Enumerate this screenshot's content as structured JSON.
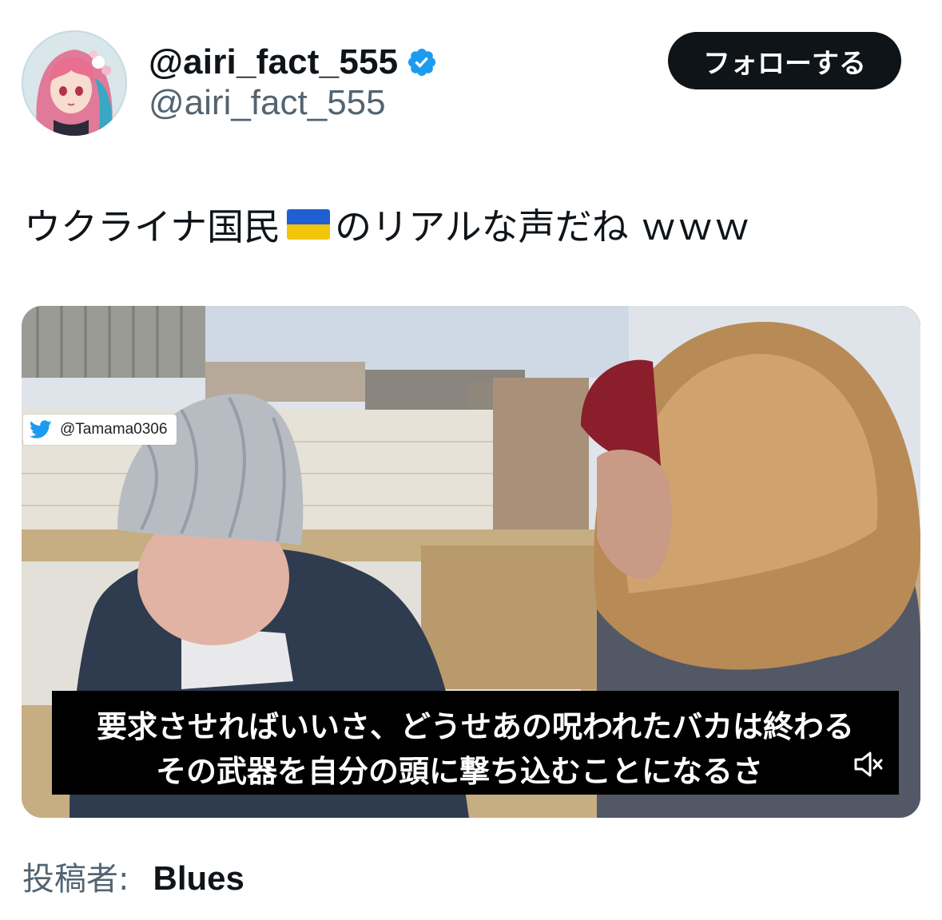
{
  "header": {
    "display_name": "@airi_fact_555",
    "handle": "@airi_fact_555",
    "verified_icon": "verified-badge-icon",
    "follow_label": "フォローする"
  },
  "tweet": {
    "text_before_flag": "ウクライナ国民",
    "flag_icon": "ukraine-flag-emoji",
    "text_after_flag": "のリアルな声だね ｗｗｗ"
  },
  "video": {
    "watermark_handle": "@Tamama0306",
    "subtitle_line1": "要求させればいいさ、どうせあの呪われたバカは終わる",
    "subtitle_line2": "その武器を自分の頭に撃ち込むことになるさ",
    "mute_icon": "speaker-muted-icon"
  },
  "footer": {
    "posted_by_label": "投稿者:",
    "posted_by_name": "Blues"
  },
  "colors": {
    "text_primary": "#0f1419",
    "text_secondary": "#536471",
    "verified_blue": "#1d9bf0",
    "follow_button_bg": "#0f1419"
  }
}
